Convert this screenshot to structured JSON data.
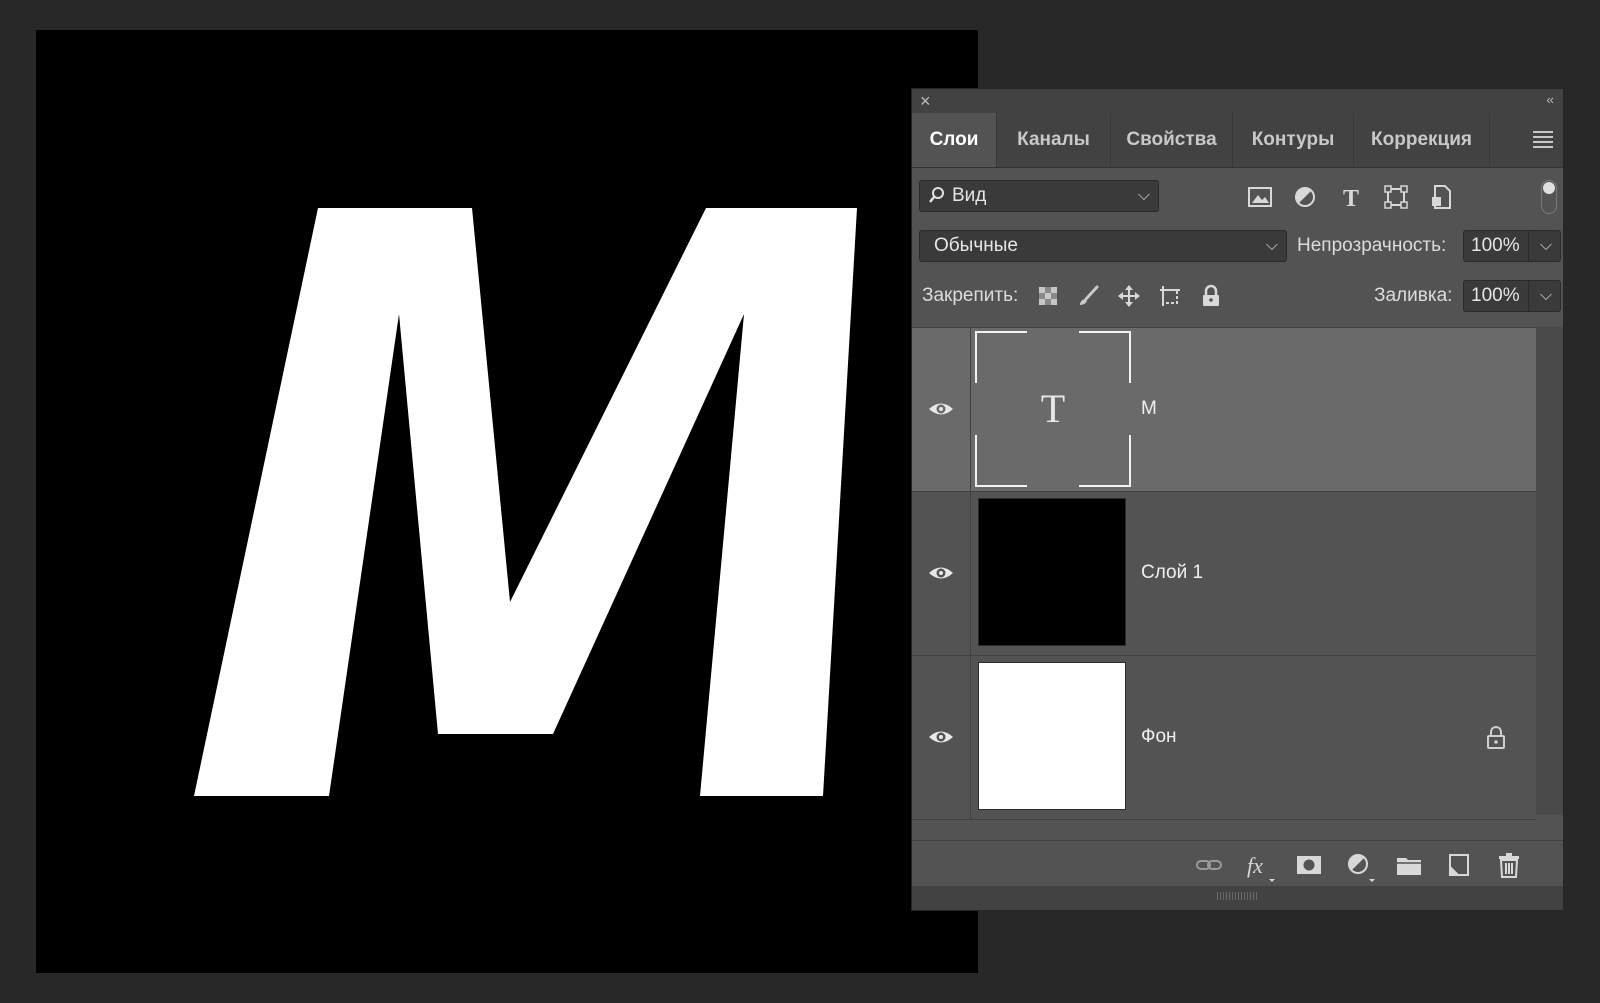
{
  "canvas": {
    "letter": "M",
    "background_color": "#000000",
    "letter_color": "#ffffff"
  },
  "panel": {
    "tabs": [
      {
        "label": "Слои",
        "active": true
      },
      {
        "label": "Каналы",
        "active": false
      },
      {
        "label": "Свойства",
        "active": false
      },
      {
        "label": "Контуры",
        "active": false
      },
      {
        "label": "Коррекция",
        "active": false
      }
    ],
    "filter": {
      "label": "Вид",
      "icons": [
        "image-filter-icon",
        "adjustment-filter-icon",
        "type-filter-icon",
        "shape-filter-icon",
        "smart-object-filter-icon"
      ]
    },
    "blend_mode": "Обычные",
    "opacity_label": "Непрозрачность:",
    "opacity_value": "100%",
    "lock_label": "Закрепить:",
    "fill_label": "Заливка:",
    "fill_value": "100%",
    "layers": [
      {
        "name": "M",
        "type": "text",
        "selected": true,
        "visible": true,
        "locked": false
      },
      {
        "name": "Слой 1",
        "type": "pixel-black",
        "selected": false,
        "visible": true,
        "locked": false
      },
      {
        "name": "Фон",
        "type": "pixel-white",
        "selected": false,
        "visible": true,
        "locked": true
      }
    ],
    "bottom_icons": [
      "link-layers-icon",
      "fx-icon",
      "add-mask-icon",
      "adjustment-layer-icon",
      "new-group-icon",
      "new-layer-icon",
      "trash-icon"
    ],
    "colors": {
      "panel_bg": "#535353",
      "tab_bar_bg": "#424242",
      "selected_layer_bg": "#6a6a6a",
      "field_bg": "#3a3a3a"
    }
  }
}
